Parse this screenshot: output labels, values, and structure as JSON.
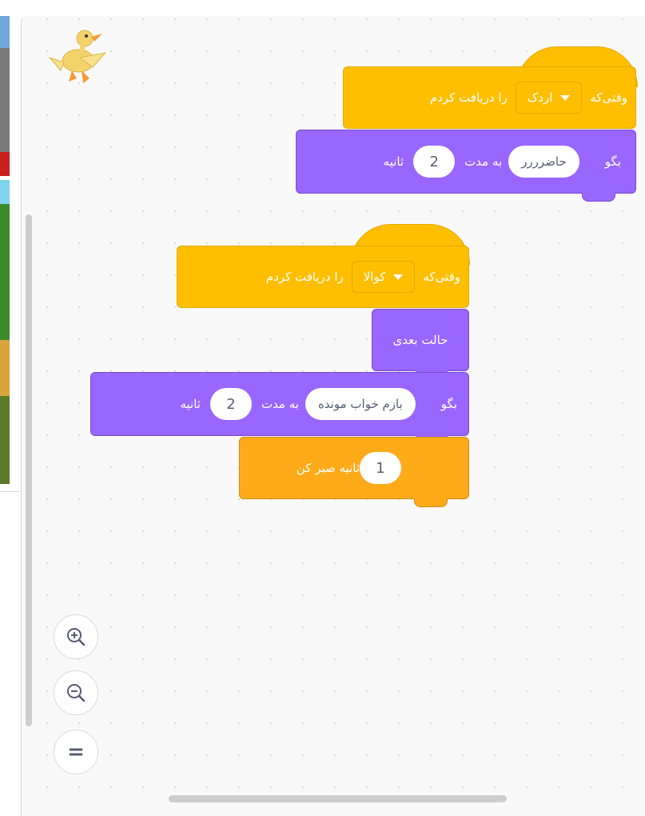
{
  "colors": {
    "event": "#ffbf00",
    "looks": "#9966ff",
    "control": "#ffab19",
    "workspace": "#f9f9f9"
  },
  "scripts": [
    {
      "hat": {
        "prefix": "وقتی‌که",
        "dropdown": "اردک",
        "suffix": "را دریافت کردم"
      },
      "say": {
        "verb": "بگو",
        "message": "حاضرررر",
        "middle": "به مدت",
        "seconds": "2",
        "unit": "ثانیه"
      }
    },
    {
      "hat": {
        "prefix": "وقتی‌که",
        "dropdown": "کوالا",
        "suffix": "را دریافت کردم"
      },
      "next_costume": "حالت بعدی",
      "say": {
        "verb": "بگو",
        "message": "بازم خواب مونده",
        "middle": "به مدت",
        "seconds": "2",
        "unit": "ثانیه"
      },
      "wait": {
        "seconds": "1",
        "suffix": "ثانیه صبر کن"
      }
    }
  ],
  "zoom": {
    "zoom_in": "zoom-in-icon",
    "zoom_out": "zoom-out-icon",
    "reset": "="
  }
}
